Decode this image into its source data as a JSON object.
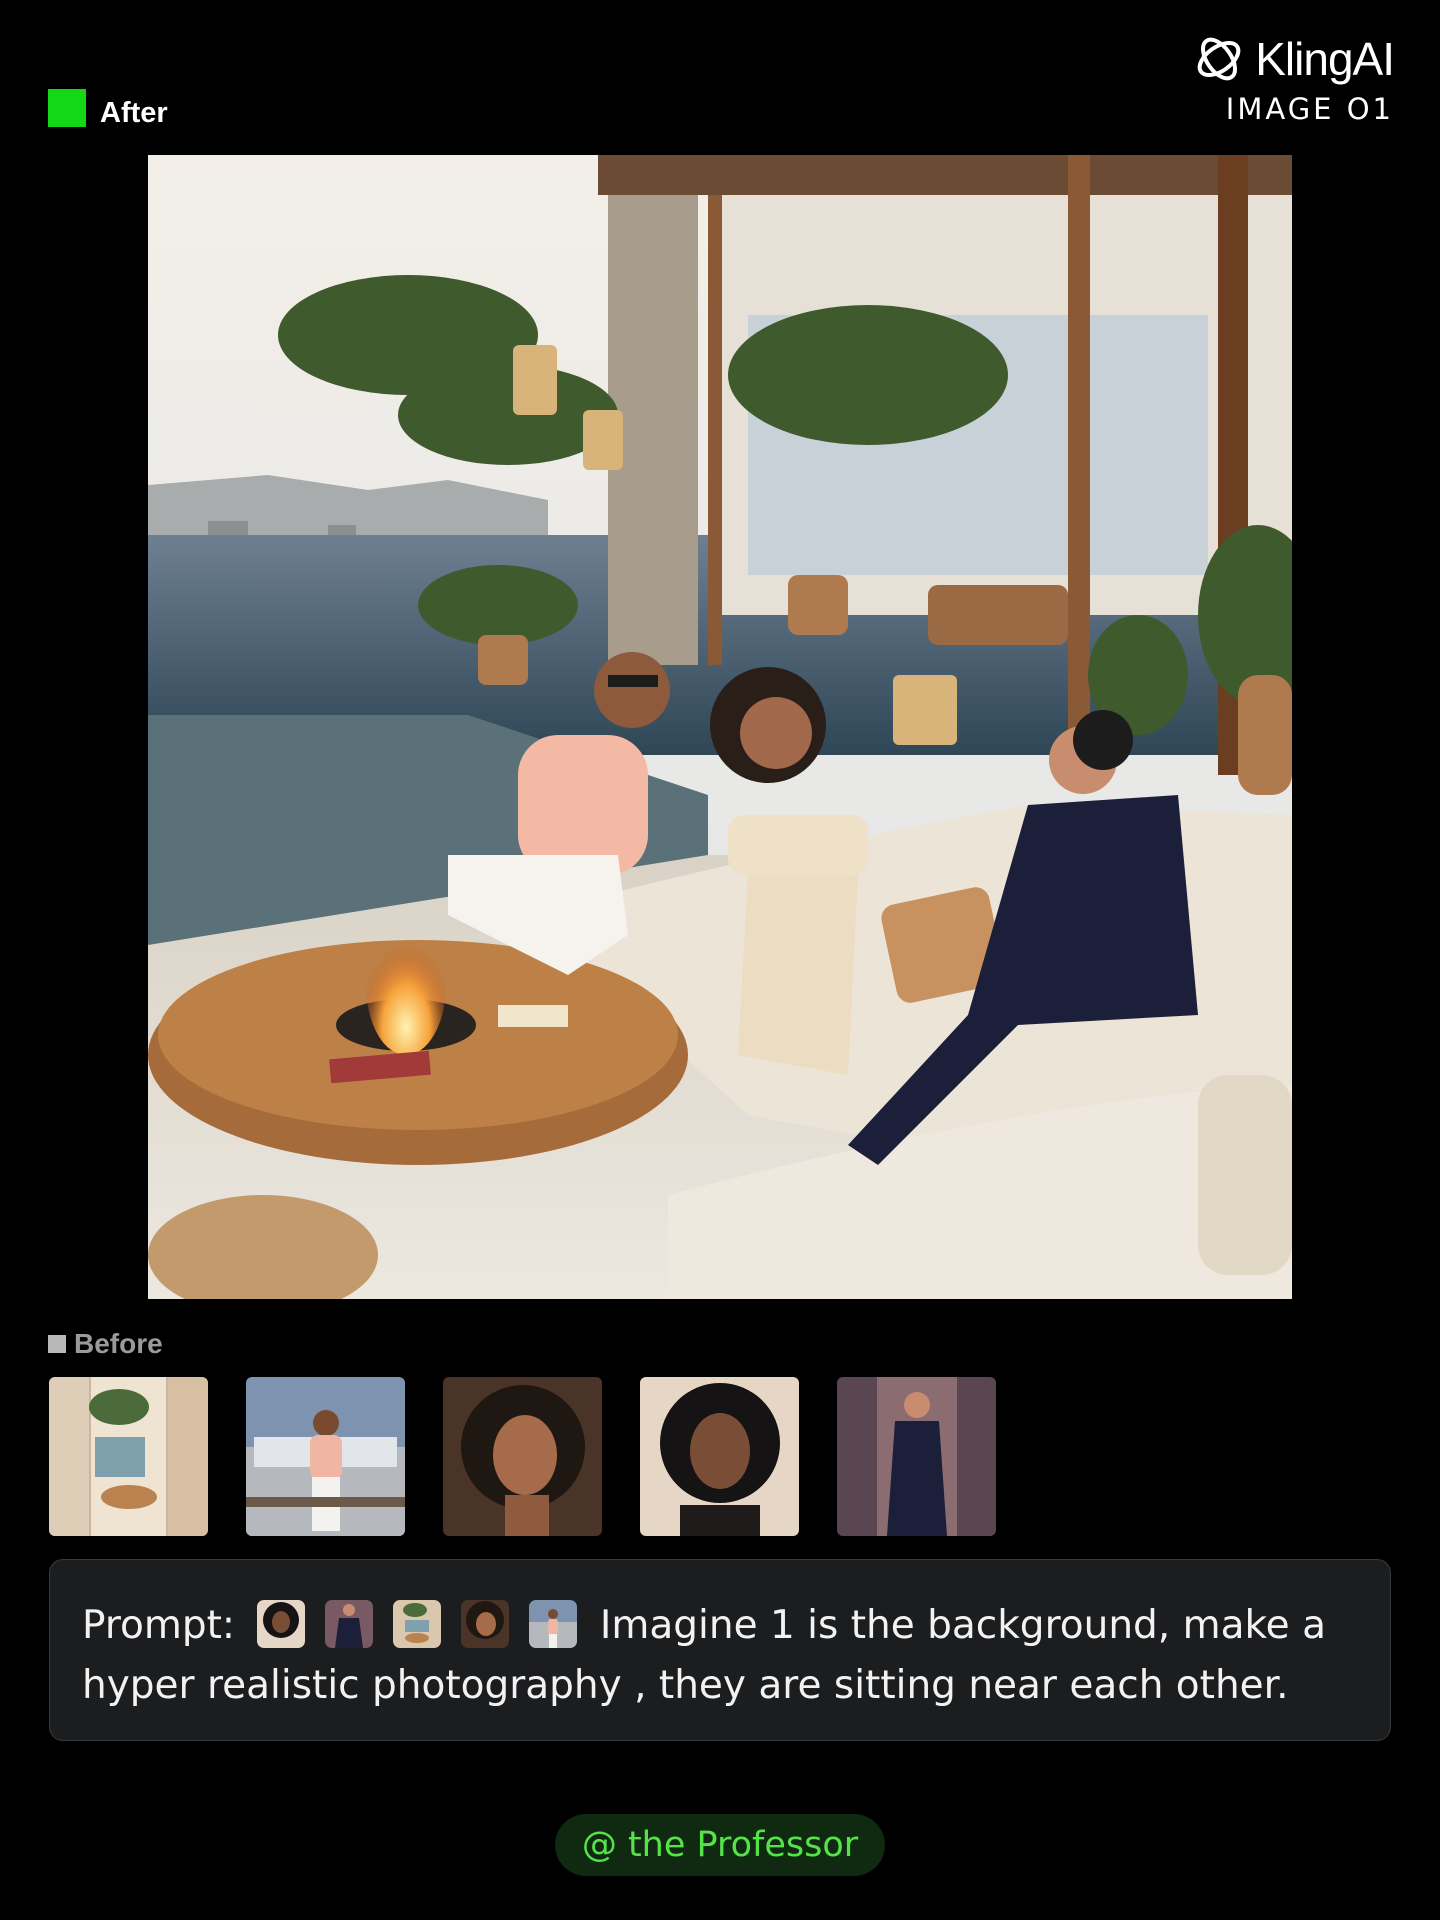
{
  "after_label": "After",
  "brand": {
    "name": "KlingAI",
    "sub": "IMAGE O1",
    "logo_icon": "kling-logo-icon"
  },
  "main_image": {
    "alt": "generated-lounge-scene",
    "icon": "photo"
  },
  "before_label": "Before",
  "before_thumbs": [
    {
      "name": "thumb-background"
    },
    {
      "name": "thumb-man-pink-shirt"
    },
    {
      "name": "thumb-woman-curly-hair"
    },
    {
      "name": "thumb-woman-long-curly-hair"
    },
    {
      "name": "thumb-woman-dark-jumpsuit"
    }
  ],
  "prompt": {
    "label": "Prompt:",
    "text_line": "Imagine 1 is the background, make a hyper realistic photography , they are sitting near each other."
  },
  "credit": "@ the Professor",
  "colors": {
    "accent_green": "#12d816",
    "credit_text": "#56e34a",
    "card_bg": "#1c1d1f"
  }
}
